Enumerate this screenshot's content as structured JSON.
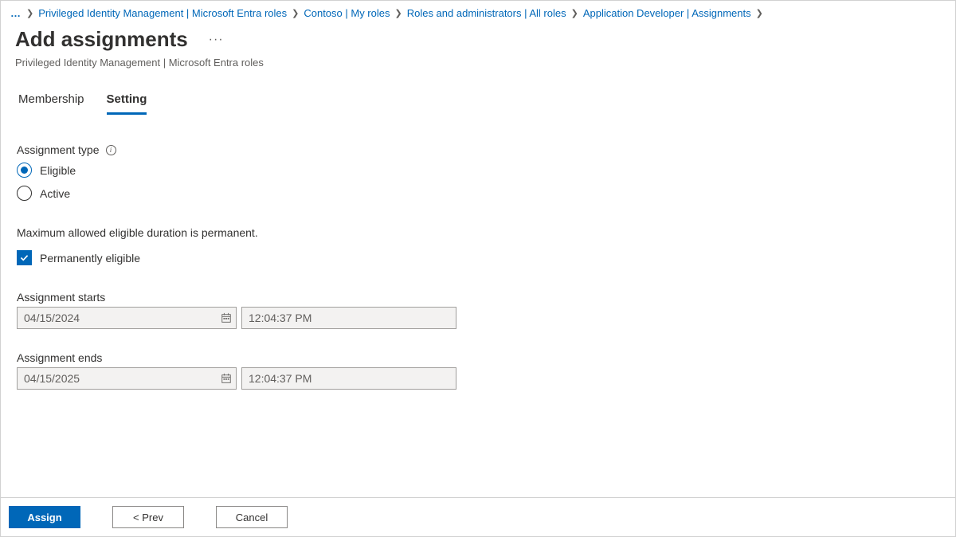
{
  "breadcrumb": {
    "more": "…",
    "items": [
      "Privileged Identity Management | Microsoft Entra roles",
      "Contoso | My roles",
      "Roles and administrators | All roles",
      "Application Developer | Assignments"
    ]
  },
  "header": {
    "title": "Add assignments",
    "subtitle": "Privileged Identity Management | Microsoft Entra roles"
  },
  "tabs": [
    {
      "label": "Membership",
      "active": false
    },
    {
      "label": "Setting",
      "active": true
    }
  ],
  "form": {
    "assignment_type_label": "Assignment type",
    "radio_eligible": "Eligible",
    "radio_active": "Active",
    "duration_info": "Maximum allowed eligible duration is permanent.",
    "permanent_label": "Permanently eligible",
    "starts_label": "Assignment starts",
    "starts_date": "04/15/2024",
    "starts_time": "12:04:37 PM",
    "ends_label": "Assignment ends",
    "ends_date": "04/15/2025",
    "ends_time": "12:04:37 PM"
  },
  "footer": {
    "assign": "Assign",
    "prev": "<  Prev",
    "cancel": "Cancel"
  }
}
